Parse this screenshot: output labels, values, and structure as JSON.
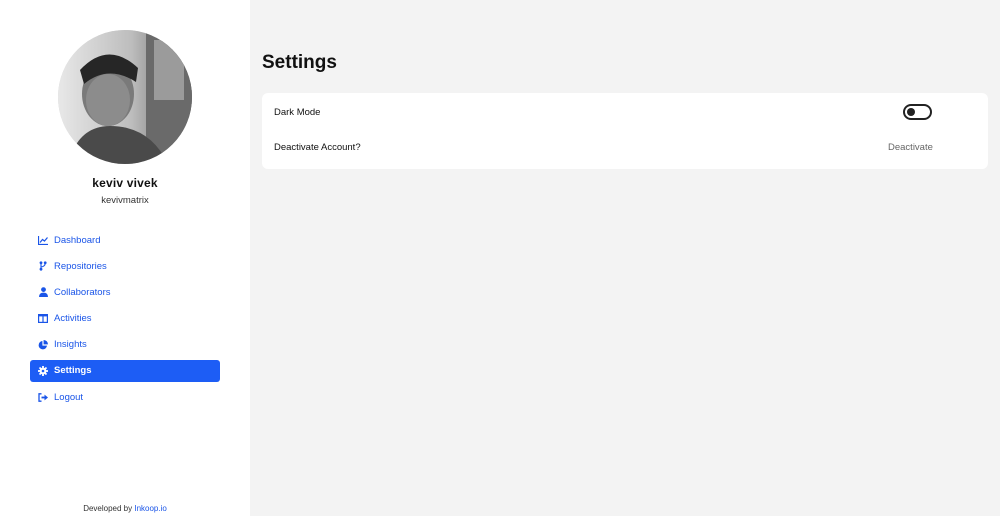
{
  "user": {
    "name": "keviv vivek",
    "handle": "kevivmatrix"
  },
  "sidebar": {
    "items": [
      {
        "label": "Dashboard",
        "icon": "chart-line-icon"
      },
      {
        "label": "Repositories",
        "icon": "code-branch-icon"
      },
      {
        "label": "Collaborators",
        "icon": "user-icon"
      },
      {
        "label": "Activities",
        "icon": "columns-icon"
      },
      {
        "label": "Insights",
        "icon": "pie-chart-icon"
      },
      {
        "label": "Settings",
        "icon": "gear-icon",
        "active": true
      },
      {
        "label": "Logout",
        "icon": "sign-out-icon"
      }
    ],
    "footer_prefix": "Developed by",
    "footer_brand": "Inkoop.io"
  },
  "main": {
    "title": "Settings",
    "settings": {
      "dark_mode_label": "Dark Mode",
      "dark_mode_on": false,
      "deactivate_label": "Deactivate Account?",
      "deactivate_button": "Deactivate"
    }
  },
  "colors": {
    "accent": "#1d5df5",
    "link": "#1a55e8",
    "background": "#f3f3f3",
    "card": "#ffffff"
  }
}
